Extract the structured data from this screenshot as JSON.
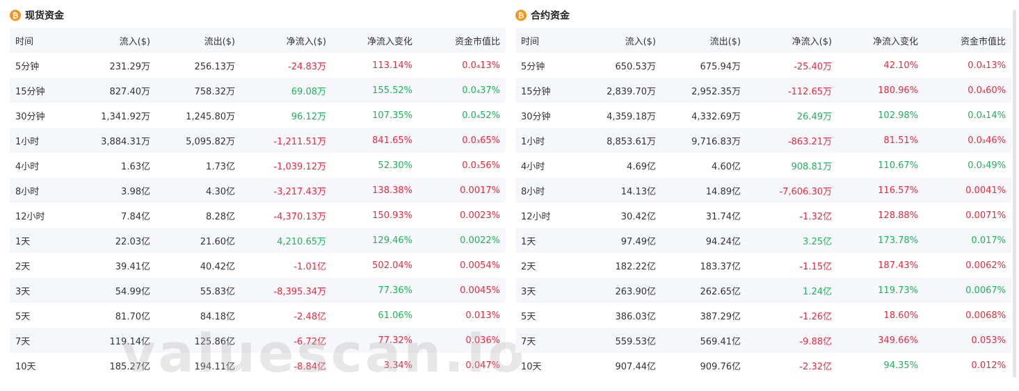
{
  "watermark": "valuescan.io",
  "colors": {
    "up": "#1fb35b",
    "down": "#f0293e",
    "coin": "#f7931a",
    "row_alt": "#f6f7fa"
  },
  "icons": {
    "coin": "bitcoin-icon"
  },
  "spot": {
    "title": "现货资金",
    "coin_glyph": "₿",
    "columns": [
      "时间",
      "流入($)",
      "流出($)",
      "净流入($)",
      "净流入变化",
      "资金市值比"
    ],
    "rows": [
      {
        "time": "5分钟",
        "inflow": "231.29万",
        "outflow": "256.13万",
        "net": "-24.83万",
        "change": "113.14%",
        "ratio": "0.0₄13%",
        "net_trend": "down",
        "change_trend": "down",
        "ratio_trend": "down"
      },
      {
        "time": "15分钟",
        "inflow": "827.40万",
        "outflow": "758.32万",
        "net": "69.08万",
        "change": "155.52%",
        "ratio": "0.0₄37%",
        "net_trend": "up",
        "change_trend": "up",
        "ratio_trend": "up"
      },
      {
        "time": "30分钟",
        "inflow": "1,341.92万",
        "outflow": "1,245.80万",
        "net": "96.12万",
        "change": "107.35%",
        "ratio": "0.0₄52%",
        "net_trend": "up",
        "change_trend": "up",
        "ratio_trend": "up"
      },
      {
        "time": "1小时",
        "inflow": "3,884.31万",
        "outflow": "5,095.82万",
        "net": "-1,211.51万",
        "change": "841.65%",
        "ratio": "0.0₃65%",
        "net_trend": "down",
        "change_trend": "down",
        "ratio_trend": "down"
      },
      {
        "time": "4小时",
        "inflow": "1.63亿",
        "outflow": "1.73亿",
        "net": "-1,039.12万",
        "change": "52.30%",
        "ratio": "0.0₃56%",
        "net_trend": "down",
        "change_trend": "up",
        "ratio_trend": "down"
      },
      {
        "time": "8小时",
        "inflow": "3.98亿",
        "outflow": "4.30亿",
        "net": "-3,217.43万",
        "change": "138.38%",
        "ratio": "0.0017%",
        "net_trend": "down",
        "change_trend": "down",
        "ratio_trend": "down"
      },
      {
        "time": "12小时",
        "inflow": "7.84亿",
        "outflow": "8.28亿",
        "net": "-4,370.13万",
        "change": "150.93%",
        "ratio": "0.0023%",
        "net_trend": "down",
        "change_trend": "down",
        "ratio_trend": "down"
      },
      {
        "time": "1天",
        "inflow": "22.03亿",
        "outflow": "21.60亿",
        "net": "4,210.65万",
        "change": "129.46%",
        "ratio": "0.0022%",
        "net_trend": "up",
        "change_trend": "up",
        "ratio_trend": "up"
      },
      {
        "time": "2天",
        "inflow": "39.41亿",
        "outflow": "40.42亿",
        "net": "-1.01亿",
        "change": "502.04%",
        "ratio": "0.0054%",
        "net_trend": "down",
        "change_trend": "down",
        "ratio_trend": "down"
      },
      {
        "time": "3天",
        "inflow": "54.99亿",
        "outflow": "55.83亿",
        "net": "-8,395.34万",
        "change": "77.36%",
        "ratio": "0.0045%",
        "net_trend": "down",
        "change_trend": "up",
        "ratio_trend": "down"
      },
      {
        "time": "5天",
        "inflow": "81.70亿",
        "outflow": "84.18亿",
        "net": "-2.48亿",
        "change": "61.06%",
        "ratio": "0.013%",
        "net_trend": "down",
        "change_trend": "up",
        "ratio_trend": "down"
      },
      {
        "time": "7天",
        "inflow": "119.14亿",
        "outflow": "125.86亿",
        "net": "-6.72亿",
        "change": "77.32%",
        "ratio": "0.036%",
        "net_trend": "down",
        "change_trend": "down",
        "ratio_trend": "down"
      },
      {
        "time": "10天",
        "inflow": "185.27亿",
        "outflow": "194.11亿",
        "net": "-8.84亿",
        "change": "3.34%",
        "ratio": "0.047%",
        "net_trend": "down",
        "change_trend": "down",
        "ratio_trend": "down"
      }
    ]
  },
  "futures": {
    "title": "合约资金",
    "coin_glyph": "₿",
    "columns": [
      "时间",
      "流入($)",
      "流出($)",
      "净流入($)",
      "净流入变化",
      "资金市值比"
    ],
    "rows": [
      {
        "time": "5分钟",
        "inflow": "650.53万",
        "outflow": "675.94万",
        "net": "-25.40万",
        "change": "42.10%",
        "ratio": "0.0₄13%",
        "net_trend": "down",
        "change_trend": "down",
        "ratio_trend": "down"
      },
      {
        "time": "15分钟",
        "inflow": "2,839.70万",
        "outflow": "2,952.35万",
        "net": "-112.65万",
        "change": "180.96%",
        "ratio": "0.0₄60%",
        "net_trend": "down",
        "change_trend": "down",
        "ratio_trend": "down"
      },
      {
        "time": "30分钟",
        "inflow": "4,359.18万",
        "outflow": "4,332.69万",
        "net": "26.49万",
        "change": "102.98%",
        "ratio": "0.0₄14%",
        "net_trend": "up",
        "change_trend": "up",
        "ratio_trend": "up"
      },
      {
        "time": "1小时",
        "inflow": "8,853.61万",
        "outflow": "9,716.83万",
        "net": "-863.21万",
        "change": "81.51%",
        "ratio": "0.0₃46%",
        "net_trend": "down",
        "change_trend": "down",
        "ratio_trend": "down"
      },
      {
        "time": "4小时",
        "inflow": "4.69亿",
        "outflow": "4.60亿",
        "net": "908.81万",
        "change": "110.67%",
        "ratio": "0.0₃49%",
        "net_trend": "up",
        "change_trend": "up",
        "ratio_trend": "up"
      },
      {
        "time": "8小时",
        "inflow": "14.13亿",
        "outflow": "14.89亿",
        "net": "-7,606.30万",
        "change": "116.57%",
        "ratio": "0.0041%",
        "net_trend": "down",
        "change_trend": "down",
        "ratio_trend": "down"
      },
      {
        "time": "12小时",
        "inflow": "30.42亿",
        "outflow": "31.74亿",
        "net": "-1.32亿",
        "change": "128.88%",
        "ratio": "0.0071%",
        "net_trend": "down",
        "change_trend": "down",
        "ratio_trend": "down"
      },
      {
        "time": "1天",
        "inflow": "97.49亿",
        "outflow": "94.24亿",
        "net": "3.25亿",
        "change": "173.78%",
        "ratio": "0.017%",
        "net_trend": "up",
        "change_trend": "up",
        "ratio_trend": "up"
      },
      {
        "time": "2天",
        "inflow": "182.22亿",
        "outflow": "183.37亿",
        "net": "-1.15亿",
        "change": "187.43%",
        "ratio": "0.0062%",
        "net_trend": "down",
        "change_trend": "down",
        "ratio_trend": "down"
      },
      {
        "time": "3天",
        "inflow": "263.90亿",
        "outflow": "262.65亿",
        "net": "1.24亿",
        "change": "119.73%",
        "ratio": "0.0067%",
        "net_trend": "up",
        "change_trend": "up",
        "ratio_trend": "up"
      },
      {
        "time": "5天",
        "inflow": "386.03亿",
        "outflow": "387.29亿",
        "net": "-1.26亿",
        "change": "18.60%",
        "ratio": "0.0068%",
        "net_trend": "down",
        "change_trend": "down",
        "ratio_trend": "down"
      },
      {
        "time": "7天",
        "inflow": "559.53亿",
        "outflow": "569.41亿",
        "net": "-9.88亿",
        "change": "349.66%",
        "ratio": "0.053%",
        "net_trend": "down",
        "change_trend": "down",
        "ratio_trend": "down"
      },
      {
        "time": "10天",
        "inflow": "907.44亿",
        "outflow": "909.76亿",
        "net": "-2.32亿",
        "change": "94.35%",
        "ratio": "0.012%",
        "net_trend": "down",
        "change_trend": "up",
        "ratio_trend": "down"
      }
    ]
  }
}
